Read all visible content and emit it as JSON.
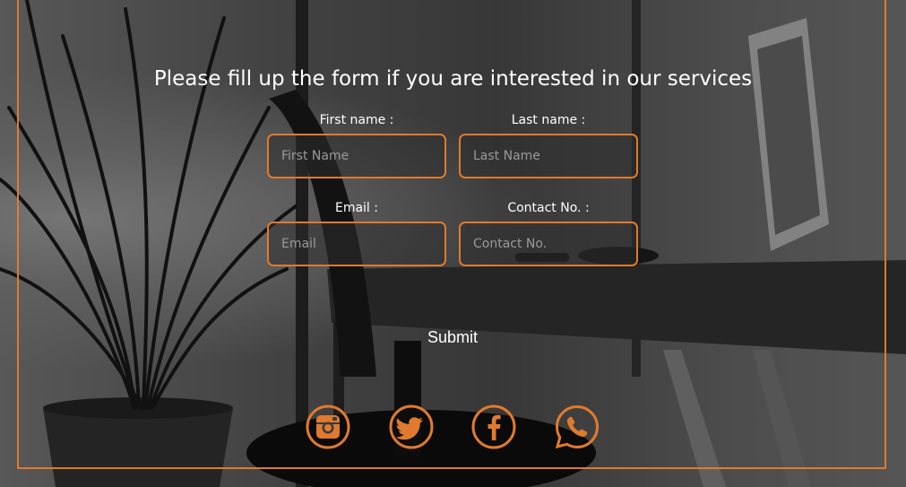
{
  "heading": "Please fill up the form if you are interested in our services",
  "form": {
    "first_name": {
      "label": "First name :",
      "placeholder": "First Name",
      "value": ""
    },
    "last_name": {
      "label": "Last name :",
      "placeholder": "Last Name",
      "value": ""
    },
    "email": {
      "label": "Email :",
      "placeholder": "Email",
      "value": ""
    },
    "contact": {
      "label": "Contact No. :",
      "placeholder": "Contact No.",
      "value": ""
    },
    "submit_label": "Submit"
  },
  "social": [
    {
      "icon": "instagram-icon"
    },
    {
      "icon": "twitter-icon"
    },
    {
      "icon": "facebook-icon"
    },
    {
      "icon": "whatsapp-icon"
    }
  ],
  "colors": {
    "accent": "#e07a2e",
    "text": "#ffffff",
    "placeholder": "#9a9a9a"
  }
}
